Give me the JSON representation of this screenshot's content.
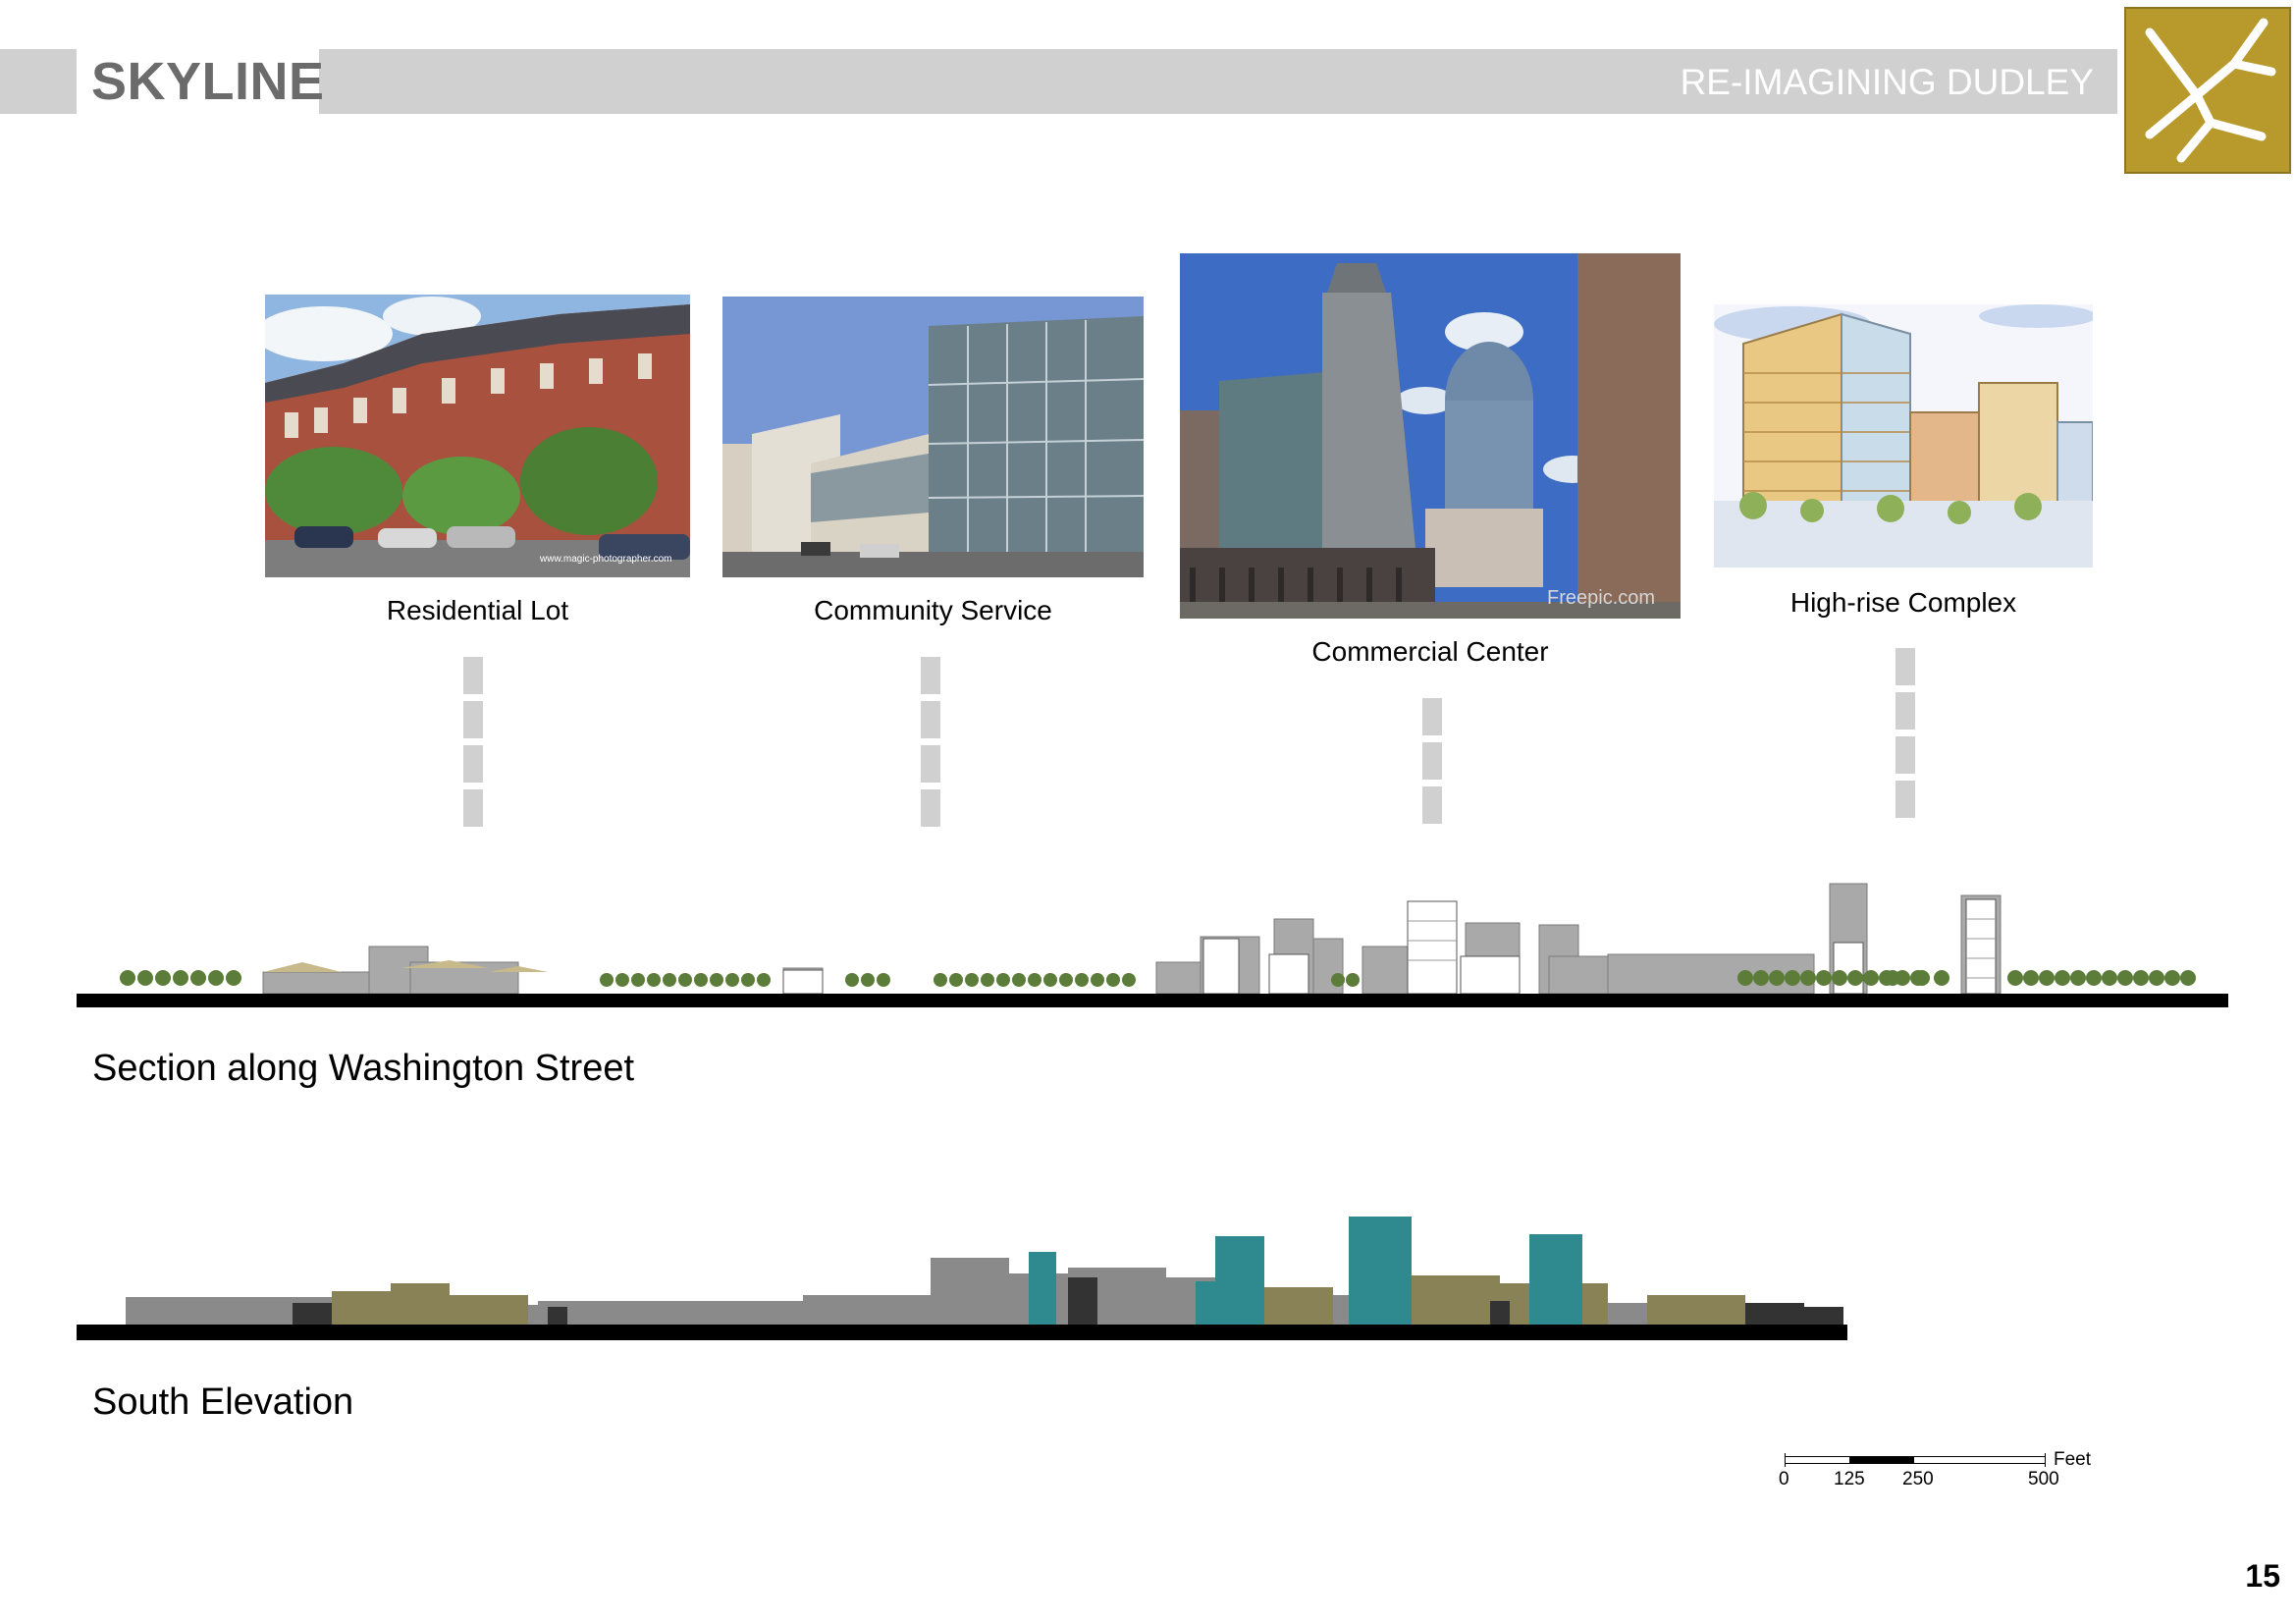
{
  "header": {
    "title": "SKYLINE",
    "subtitle": "RE-IMAGINING DUDLEY",
    "logo_icon": "dudley-street-map-logo",
    "colors": {
      "band": "#d0d0d0",
      "logo_bg": "#b8992c",
      "title": "#6b6b6b"
    }
  },
  "photos": [
    {
      "caption": "Residential Lot",
      "watermark": "www.magic-photographer.com"
    },
    {
      "caption": "Community Service"
    },
    {
      "caption": "Commercial Center",
      "watermark": "Freepic.com"
    },
    {
      "caption": "High-rise Complex"
    }
  ],
  "sections": {
    "washington_label": "Section along Washington Street",
    "south_label": "South Elevation"
  },
  "scale_bar": {
    "unit": "Feet",
    "ticks": [
      "0",
      "125",
      "250",
      "500"
    ]
  },
  "page_number": "15",
  "palette": {
    "teal": "#2e8a8f",
    "olive": "#8a8257",
    "gray": "#8a8a8a",
    "dark": "#333333"
  }
}
